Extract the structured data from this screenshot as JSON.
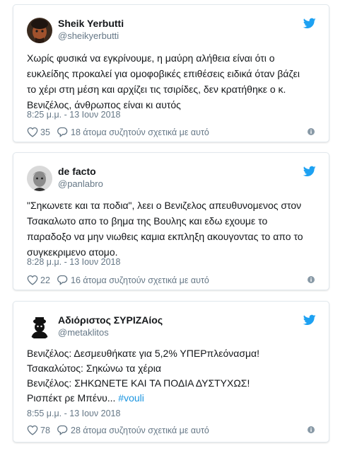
{
  "colors": {
    "accent": "#1da1f2",
    "text": "#14171a",
    "muted": "#657786",
    "hashtag": "#1b95e0",
    "border": "#e1e8ed"
  },
  "tweets": [
    {
      "name": "Sheik Yerbutti",
      "handle": "@sheikyerbutti",
      "lines": [
        "Χωρίς φυσικά να εγκρίνουμε, η μαύρη αλήθεια είναι ότι ο",
        "ευκλείδης προκαλεί για ομοφοβικές επιθέσεις ειδικά όταν βάζει",
        "το χέρι στη μέση και αρχίζει τις τσιρίδες, δεν κρατήθηκε ο κ.",
        "Βενιζέλος, άνθρωπος είναι κι αυτός"
      ],
      "timestamp": "8:25 μ.μ. - 13 Ιουν 2018",
      "likes": "35",
      "replies": "18 άτομα συζητούν σχετικά με αυτό",
      "avatar_icon": "avatar-portrait-icon"
    },
    {
      "name": "de facto",
      "handle": "@panlabro",
      "lines": [
        "\"Σηκωνετε και τα ποδια\", λεει ο Βενιζελος απευθυνομενος στον",
        "Τσακαλωτο απο το βημα της Βουλης και εδω εχουμε το",
        "παραδοξο να μην νιωθεις καμια εκπληξη ακουγοντας το απο το",
        "συγκεκριμενο ατομο."
      ],
      "timestamp": "8:28 μ.μ. - 13 Ιουν 2018",
      "likes": "22",
      "replies": "16 άτομα συζητούν σχετικά με αυτό",
      "avatar_icon": "avatar-bw-portrait-icon"
    },
    {
      "name": "Αδιόριστος ΣΥΡΙΖΑίος",
      "handle": "@metaklitos",
      "lines": [
        "Βενιζέλος: Δεσμευθήκατε για 5,2% ΥΠΕΡπλεόνασμα!",
        "Τσακαλώτος: Σηκώνω τα χέρια",
        "Βενιζέλος: ΣΗΚΩΝΕΤΕ ΚΑΙ ΤΑ ΠΟΔΙΑ ΔΥΣΤΥΧΩΣ!"
      ],
      "last_line_text": "Ρισπέκτ ρε Μπένυ... ",
      "hashtag": "#vouli",
      "timestamp": "8:55 μ.μ. - 13 Ιουν 2018",
      "likes": "78",
      "replies": "28 άτομα συζητούν σχετικά με αυτό",
      "avatar_icon": "avatar-silhouette-icon"
    }
  ],
  "icons": {
    "brand": "twitter-bird-icon",
    "like": "heart-icon",
    "reply": "reply-bubble-icon",
    "info": "info-icon"
  }
}
